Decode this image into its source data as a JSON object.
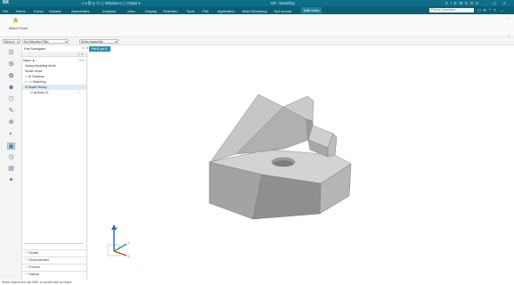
{
  "app": {
    "logo": "NX",
    "qat_text": "≡ ▾ ⎘ ◎ ↻ ▢ Window ▾ ▢ Graph ▾",
    "title": "NX - Modeling",
    "window_controls": "SIEMENS _ ▢ ✕"
  },
  "menubar": {
    "items": [
      "File",
      "Home",
      "Curve",
      "Surface",
      "Assemblies",
      "Analysis",
      "View",
      "Display",
      "Selection",
      "Tools",
      "PMI",
      "Application",
      "Mold Wizarding",
      "Tool wordst",
      "Infill extra"
    ],
    "active_index": 14,
    "search_placeholder": "Find a Command",
    "right_icons": [
      "◻",
      "⟲",
      "⌃",
      "?",
      "⌄"
    ]
  },
  "ribbon": {
    "favorite_label": "Attach Pinned",
    "collapse_glyph": "⌃",
    "more_glyph": "⌄"
  },
  "selection_bar": {
    "filter_value": "Menu ▾",
    "type_filter_value": "No Selection Filter",
    "scope_value": "Entire Assembly"
  },
  "tabs": {
    "part_navigator_label": "Part Navigator",
    "active_tab": "Part1.prt ✕",
    "panel_icons": "▢ ✕"
  },
  "resource_bar": {
    "icons": [
      "☰",
      "⚙",
      "✿",
      "☻",
      "⬡",
      "✎",
      "⊕",
      "◐",
      "▣",
      "◷",
      "▤",
      "✦"
    ],
    "selected_index": 8
  },
  "part_navigator": {
    "header": "Part Navigator",
    "header_icons": "▢ ✕",
    "tree": [
      {
        "label": "Name ▲",
        "indent": 1,
        "check": "",
        "suffix": "⟳ ▾",
        "selected": false
      },
      {
        "label": "History Modeling Mode",
        "indent": 3,
        "check": "",
        "suffix": "",
        "selected": false
      },
      {
        "label": "Model Views",
        "indent": 3,
        "check": "",
        "suffix": "",
        "selected": false
      },
      {
        "label": "✓ ⊕ Cameras",
        "indent": 3,
        "check": "",
        "suffix": "",
        "selected": false
      },
      {
        "label": "✓ ⌥ Sketching",
        "indent": 3,
        "check": "",
        "suffix": "",
        "selected": false
      },
      {
        "label": "⊖ Model History",
        "indent": 3,
        "check": "",
        "suffix": "",
        "selected": true
      },
      {
        "label": "☑ ◈ Body (1)",
        "indent": 9,
        "check": "✓",
        "suffix": "",
        "selected": false
      }
    ],
    "sections": [
      "Details",
      "Dependencies",
      "Preview",
      "Display"
    ],
    "section_glyph": "+"
  },
  "viewport": {
    "triad_labels": {
      "z": "Z",
      "y": "Y",
      "x": "X"
    }
  },
  "status": {
    "text": "Select objects and use MB3, or double-click an object"
  },
  "colors": {
    "titlebar": "#0e6f86",
    "menubar": "#0a5f74",
    "active_tab": "#1d84a0",
    "model_top": "#d3d3d3",
    "model_front": "#8f8f8f",
    "model_side": "#b5b5b5"
  }
}
